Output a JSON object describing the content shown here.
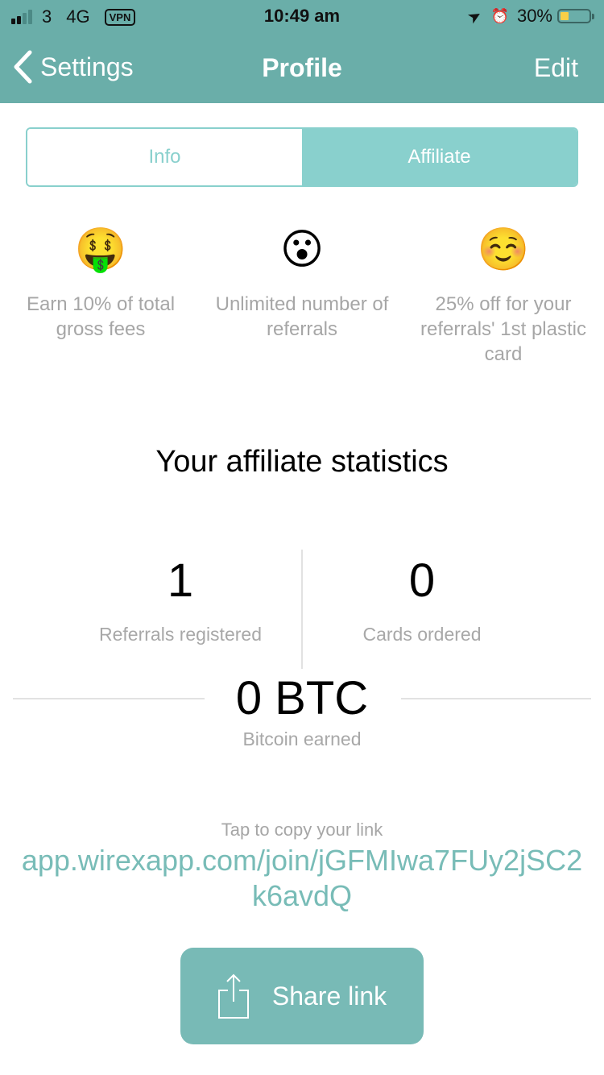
{
  "status_bar": {
    "signal_bars_active": 2,
    "signal_bars_total": 4,
    "carrier": "3",
    "network": "4G",
    "vpn_label": "VPN",
    "time": "10:49 am",
    "location_icon": "location-arrow-icon",
    "alarm_icon": "alarm-clock-icon",
    "battery_text": "30%",
    "battery_level": 0.3
  },
  "nav": {
    "back_label": "Settings",
    "title": "Profile",
    "edit_label": "Edit"
  },
  "tabs": [
    {
      "label": "Info",
      "active": false
    },
    {
      "label": "Affiliate",
      "active": true
    }
  ],
  "features": [
    {
      "emoji": "🤑",
      "icon": "money-mouth-face-icon",
      "text": "Earn 10% of total gross fees"
    },
    {
      "emoji": "😮",
      "icon": "surprised-face-icon",
      "text": "Unlimited number of referrals"
    },
    {
      "emoji": "☺️",
      "icon": "smiling-face-icon",
      "text": "25% off for your referrals' 1st plastic card"
    }
  ],
  "stats": {
    "title": "Your affiliate statistics",
    "referrals": {
      "value": "1",
      "label": "Referrals registered"
    },
    "cards": {
      "value": "0",
      "label": "Cards ordered"
    },
    "bitcoin": {
      "value": "0 BTC",
      "label": "Bitcoin earned"
    }
  },
  "link": {
    "hint": "Tap to copy your link",
    "url": "app.wirexapp.com/join/jGFMIwa7FUy2jSC2k6avdQ"
  },
  "share": {
    "label": "Share link",
    "icon": "share-icon"
  },
  "colors": {
    "header": "#6aaea9",
    "tab_accent": "#89d0cd",
    "link": "#78bcb7",
    "button": "#78bab6",
    "muted_text": "#a6a6a6",
    "battery": "#f7cf47"
  }
}
